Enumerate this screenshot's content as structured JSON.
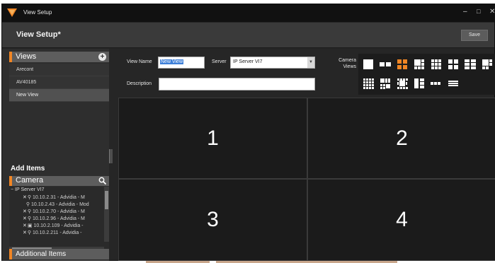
{
  "window": {
    "title": "View Setup",
    "controls": {
      "minimize": "–",
      "maximize": "□",
      "close": "✕"
    }
  },
  "header": {
    "title": "View Setup*",
    "save_label": "Save"
  },
  "sidebar": {
    "views_label": "Views",
    "views": [
      "Arecont",
      "AV40185",
      "New View"
    ],
    "selected_view_index": 2,
    "add_items_label": "Add Items",
    "camera_label": "Camera",
    "tree_root": "− IP Server VI7",
    "cameras": [
      "10.10.2.31 - Advidia - M",
      "10.10.2.43 - Advidia - Mod",
      "10.10.2.70 - Advidia - M",
      "10.10.2.96 - Advidia - M",
      "10.10.2.109 - Advidia -",
      "10.10.2.211 - Advidia -"
    ],
    "additional_items_label": "Additional Items"
  },
  "form": {
    "view_name_label": "View Name",
    "view_name_value": "New View",
    "server_label": "Server",
    "server_value": "IP Server VI7",
    "description_label": "Description",
    "description_value": "",
    "camera_views_label_line1": "Camera",
    "camera_views_label_line2": "Views"
  },
  "layout_options": [
    "1x1",
    "1x2",
    "2x2",
    "1+5",
    "3x3",
    "2x2-alt",
    "4x4",
    "1+7",
    "5x5",
    "2+8",
    "1+12",
    "3x4",
    "1x3",
    "3x1"
  ],
  "selected_layout_index": 2,
  "grid_cells": [
    "1",
    "2",
    "3",
    "4"
  ],
  "colors": {
    "accent": "#f08524",
    "selection": "#3d7fd8"
  }
}
